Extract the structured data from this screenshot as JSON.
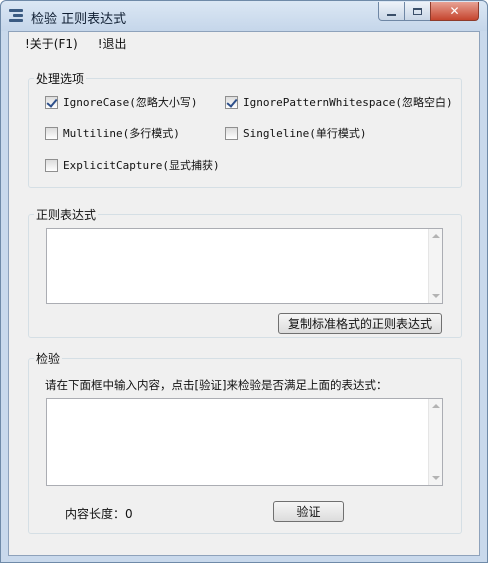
{
  "window": {
    "title": "检验 正则表达式",
    "controls": {
      "close_glyph": "✕"
    }
  },
  "menu": [
    {
      "label": "!关于(F1)"
    },
    {
      "label": "!退出"
    }
  ],
  "options": {
    "legend": "处理选项",
    "items": [
      {
        "label": "IgnoreCase(忽略大小写)",
        "checked": true
      },
      {
        "label": "IgnorePatternWhitespace(忽略空白)",
        "checked": true
      },
      {
        "label": "Multiline(多行模式)",
        "checked": false
      },
      {
        "label": "Singleline(单行模式)",
        "checked": false
      },
      {
        "label": "ExplicitCapture(显式捕获)",
        "checked": false
      }
    ]
  },
  "regex": {
    "legend": "正则表达式",
    "value": "",
    "copy_button": "复制标准格式的正则表达式"
  },
  "verify": {
    "legend": "检验",
    "instruction": "请在下面框中输入内容，点击[验证]来检验是否满足上面的表达式：",
    "value": "",
    "length_label": "内容长度：",
    "length_value": "0",
    "verify_button": "验证"
  }
}
